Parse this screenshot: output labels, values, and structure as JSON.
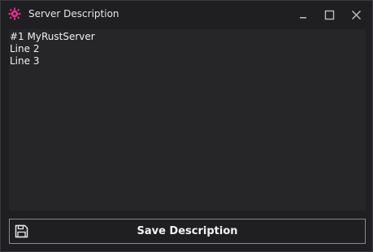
{
  "window": {
    "title": "Server Description",
    "icon": "rust-gear-icon",
    "controls": [
      "minimize-icon",
      "maximize-icon",
      "close-icon"
    ]
  },
  "editor": {
    "lines": [
      "#1 MyRustServer",
      "Line 2",
      "Line 3"
    ]
  },
  "save_button": {
    "label": "Save Description",
    "icon": "floppy-disk-icon"
  },
  "colors": {
    "background": "#1f1f22",
    "editor_background": "#262629",
    "accent_icon": "#e0308c"
  }
}
